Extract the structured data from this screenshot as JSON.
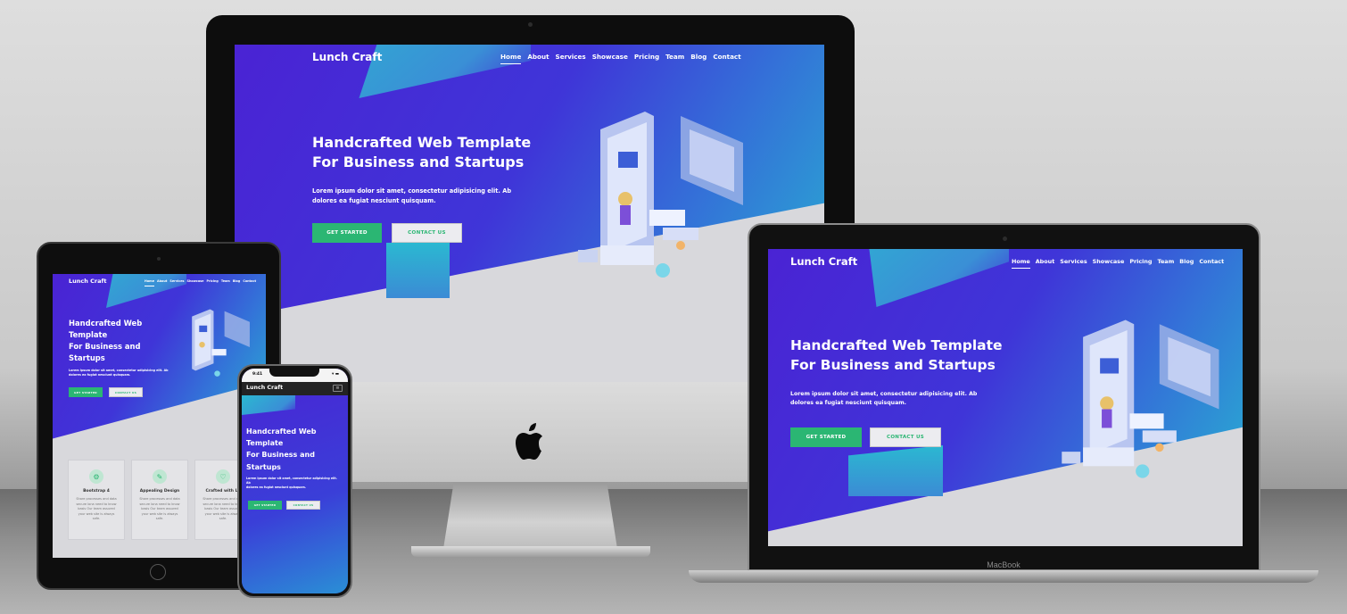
{
  "site": {
    "brand": "Lunch Craft",
    "nav": [
      "Home",
      "About",
      "Services",
      "Showcase",
      "Pricing",
      "Team",
      "Blog",
      "Contact"
    ],
    "active_nav": "Home",
    "hero_title_line1": "Handcrafted Web Template",
    "hero_title_line2": "For Business and Startups",
    "ipad_title_line1": "Handcrafted Web",
    "ipad_title_line2": "Template",
    "ipad_title_line3": "For Business and",
    "ipad_title_line4": "Startups",
    "hero_text_line1": "Lorem ipsum dolor sit amet, consectetur adipisicing elit. Ab",
    "hero_text_line2": "dolores ea fugiat nesciunt quisquam.",
    "phone_text_line1": "Lorem ipsum dolor sit amet, consectetur adipisicing elit.",
    "phone_text_line2": "Ab",
    "btn_primary": "GET STARTED",
    "btn_secondary": "CONTACT US",
    "features": [
      {
        "icon": "bootstrap-icon",
        "title": "Bootstrap 4",
        "text": "Share processes and data secure lona need to know basis Our team assured your web site is always safe."
      },
      {
        "icon": "brush-icon",
        "title": "Appealing Design",
        "text": "Share processes and data secure lona need to know basis Our team assured your web site is always safe."
      },
      {
        "icon": "heart-icon",
        "title": "Crafted with Lo",
        "text": "Share processes and data secure lona need to know basis Our team assured your web site is always safe."
      }
    ]
  },
  "devices": {
    "laptop_label": "MacBook",
    "phone_time": "9:41"
  },
  "colors": {
    "hero_start": "#4a23d4",
    "hero_end": "#27b6d1",
    "button_green": "#2bb673",
    "light_section": "#d8d8dc"
  }
}
